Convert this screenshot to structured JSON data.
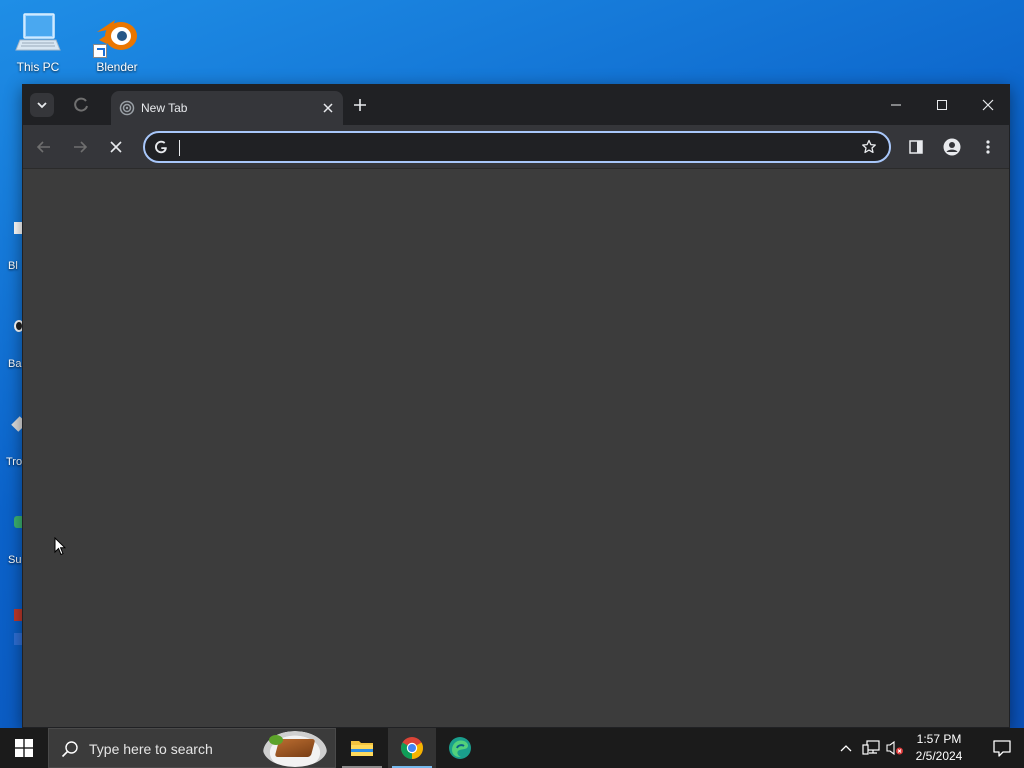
{
  "desktop": {
    "icons": [
      {
        "label": "This PC",
        "icon": "computer-icon"
      },
      {
        "label": "Blender",
        "icon": "blender-icon"
      }
    ],
    "peek_labels": [
      "Bl",
      "Ba",
      "Tro",
      "Su"
    ]
  },
  "browser": {
    "tab": {
      "title": "New Tab"
    },
    "omnibox": {
      "value": "",
      "placeholder": ""
    },
    "content_color": "#3c3c3c",
    "accent": "#a8c7fa"
  },
  "taskbar": {
    "search_placeholder": "Type here to search",
    "clock_time": "1:57 PM",
    "clock_date": "2/5/2024",
    "apps": [
      "file-explorer-icon",
      "chrome-icon",
      "edge-icon"
    ]
  }
}
